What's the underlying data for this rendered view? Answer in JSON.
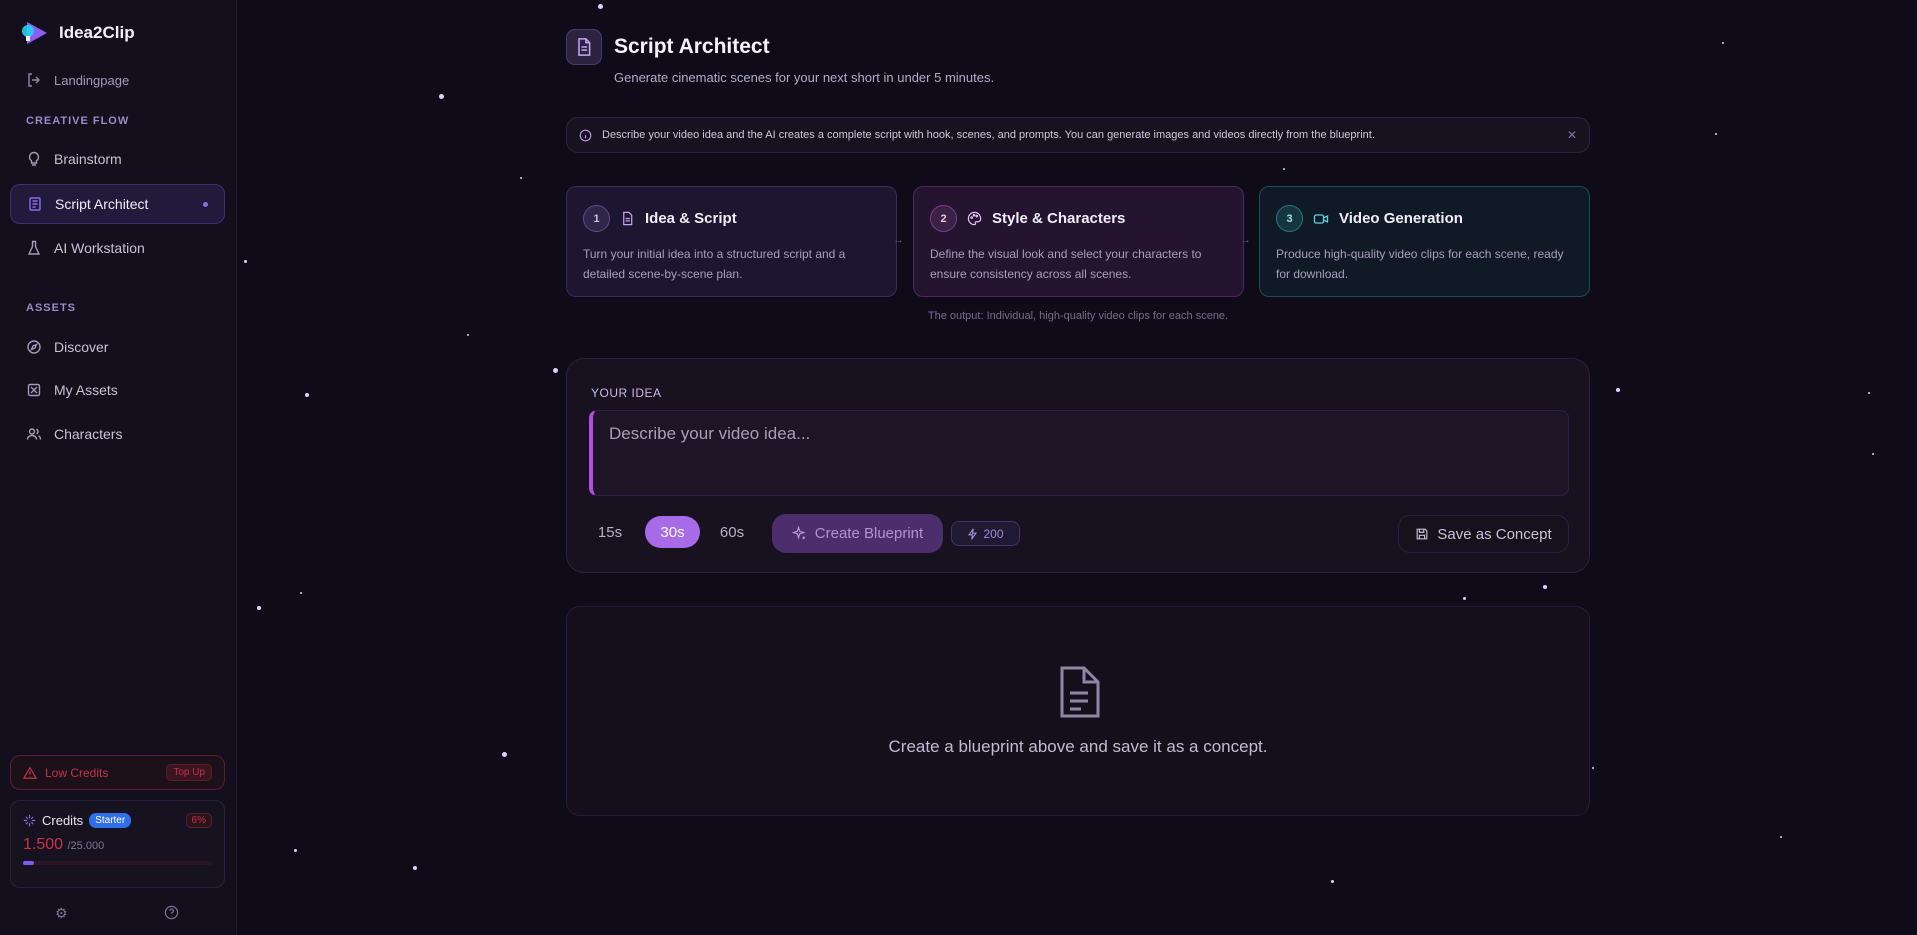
{
  "app": {
    "name": "Idea2Clip"
  },
  "sidebar": {
    "landing": "Landingpage",
    "creative_flow_label": "CREATIVE FLOW",
    "creative_items": [
      {
        "label": "Brainstorm",
        "icon": "lightbulb-icon"
      },
      {
        "label": "Script Architect",
        "icon": "script-icon",
        "active": true
      },
      {
        "label": "AI Workstation",
        "icon": "flask-icon"
      }
    ],
    "assets_label": "ASSETS",
    "asset_items": [
      {
        "label": "Discover",
        "icon": "compass-icon"
      },
      {
        "label": "My Assets",
        "icon": "assets-icon"
      },
      {
        "label": "Characters",
        "icon": "users-icon"
      }
    ],
    "low_credits": {
      "label": "Low Credits",
      "action": "Top Up"
    },
    "credits": {
      "label": "Credits",
      "plan": "Starter",
      "percent": "6%",
      "value": "1.500",
      "total": "/25.000",
      "fraction": 0.06
    }
  },
  "header": {
    "title": "Script Architect",
    "subtitle": "Generate cinematic scenes for your next short in under 5 minutes."
  },
  "info": {
    "text": "Describe your video idea and the AI creates a complete script with hook, scenes, and prompts. You can generate images and videos directly from the blueprint."
  },
  "steps": [
    {
      "num": "1",
      "title": "Idea & Script",
      "desc": "Turn your initial idea into a structured script and a detailed scene-by-scene plan."
    },
    {
      "num": "2",
      "title": "Style & Characters",
      "desc": "Define the visual look and select your characters to ensure consistency across all scenes."
    },
    {
      "num": "3",
      "title": "Video Generation",
      "desc": "Produce high-quality video clips for each scene, ready for download."
    }
  ],
  "output_note": "The output: Individual, high-quality video clips for each scene.",
  "idea": {
    "label": "YOUR IDEA",
    "placeholder": "Describe your video idea...",
    "durations": [
      "15s",
      "30s",
      "60s"
    ],
    "selected_duration": "30s",
    "create_label": "Create Blueprint",
    "cost": "200",
    "save_label": "Save as Concept"
  },
  "empty_state": {
    "text": "Create a blueprint above and save it as a concept."
  },
  "colors": {
    "accent": "#a86be8",
    "brand": "#7c5cf5",
    "danger": "#c0334d",
    "background": "#0f0b18"
  }
}
